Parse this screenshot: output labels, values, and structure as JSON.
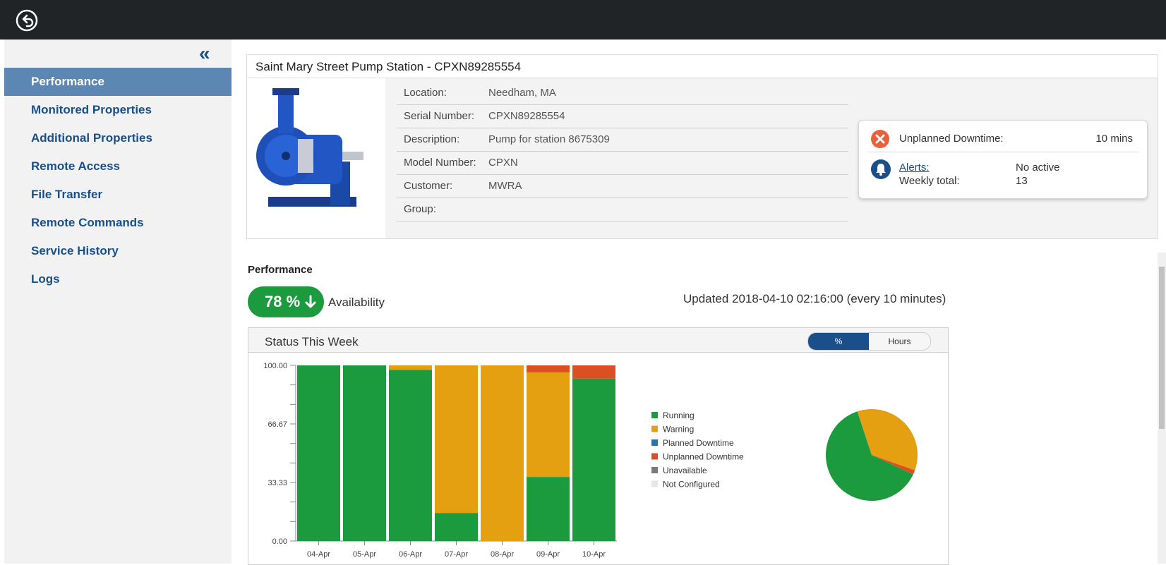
{
  "sidebar": {
    "collapse_label": "«",
    "items": [
      {
        "label": "Performance",
        "active": true
      },
      {
        "label": "Monitored Properties"
      },
      {
        "label": "Additional Properties"
      },
      {
        "label": "Remote Access"
      },
      {
        "label": "File Transfer"
      },
      {
        "label": "Remote Commands"
      },
      {
        "label": "Service History"
      },
      {
        "label": "Logs"
      }
    ]
  },
  "asset": {
    "title": "Saint Mary Street Pump Station - CPXN89285554",
    "fields": [
      {
        "label": "Location:",
        "value": "Needham, MA"
      },
      {
        "label": "Serial Number:",
        "value": "CPXN89285554"
      },
      {
        "label": "Description:",
        "value": "Pump for station 8675309"
      },
      {
        "label": "Model Number:",
        "value": "CPXN"
      },
      {
        "label": "Customer:",
        "value": "MWRA"
      },
      {
        "label": "Group:",
        "value": ""
      }
    ]
  },
  "status": {
    "downtime_label": "Unplanned Downtime:",
    "downtime_value": "10 mins",
    "alerts_label": "Alerts:",
    "alerts_value": "No active",
    "weekly_label": "Weekly total:",
    "weekly_value": "13"
  },
  "performance": {
    "heading": "Performance",
    "availability_value": "78 %",
    "availability_label": "Availability",
    "updated_text": "Updated 2018-04-10 02:16:00 (every 10 minutes)"
  },
  "chart_panel": {
    "title": "Status This Week",
    "toggle_percent": "%",
    "toggle_hours": "Hours"
  },
  "colors": {
    "running": "#1c9a3e",
    "warning": "#e5a012",
    "planned": "#1f78b4",
    "unplanned": "#dc4f25",
    "unavailable": "#7a7a7a",
    "not_configured": "#e6e6e6",
    "accent": "#1a4f8a"
  },
  "chart_data": [
    {
      "type": "bar",
      "stacked": true,
      "categories": [
        "04-Apr",
        "05-Apr",
        "06-Apr",
        "07-Apr",
        "08-Apr",
        "09-Apr",
        "10-Apr"
      ],
      "yticks": [
        "0.00",
        "33.33",
        "66.67",
        "100.00"
      ],
      "ylim": [
        0,
        100
      ],
      "series": [
        {
          "name": "Running",
          "values": [
            100,
            100,
            97.5,
            16,
            0,
            36.5,
            92.5
          ]
        },
        {
          "name": "Warning",
          "values": [
            0,
            0,
            2.5,
            84,
            100,
            59.5,
            0
          ]
        },
        {
          "name": "Planned Downtime",
          "values": [
            0,
            0,
            0,
            0,
            0,
            0,
            0
          ]
        },
        {
          "name": "Unplanned Downtime",
          "values": [
            0,
            0,
            0,
            0,
            0,
            4,
            7.5
          ]
        },
        {
          "name": "Unavailable",
          "values": [
            0,
            0,
            0,
            0,
            0,
            0,
            0
          ]
        },
        {
          "name": "Not Configured",
          "values": [
            0,
            0,
            0,
            0,
            0,
            0,
            0
          ]
        }
      ],
      "legend": "right"
    },
    {
      "type": "pie",
      "slices": [
        {
          "name": "Running",
          "value": 63
        },
        {
          "name": "Warning",
          "value": 35.5
        },
        {
          "name": "Unplanned Downtime",
          "value": 1.5
        }
      ]
    }
  ]
}
